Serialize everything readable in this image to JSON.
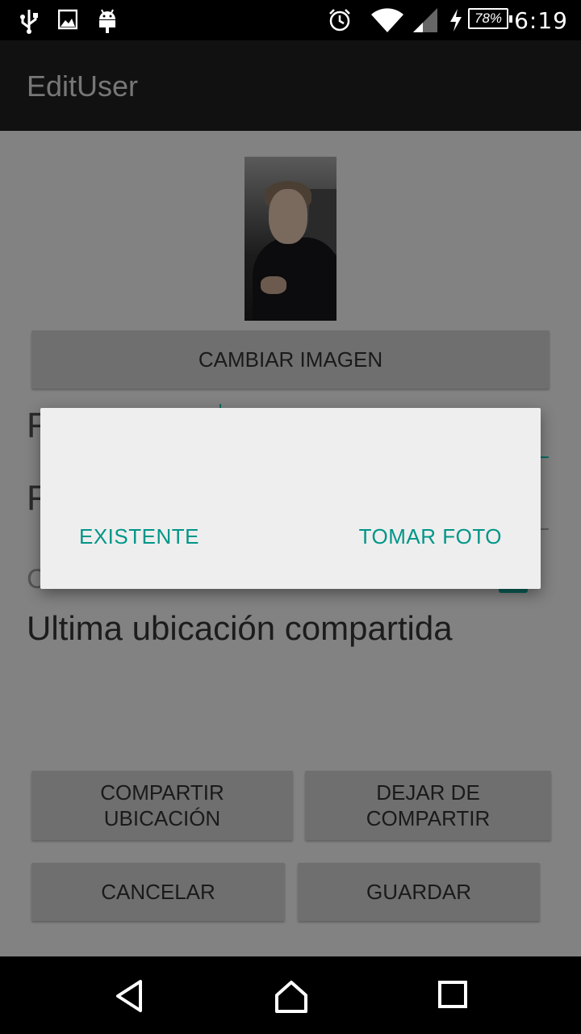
{
  "status_bar": {
    "time": "6:19",
    "battery": "78%",
    "icons": [
      "usb-icon",
      "image-icon",
      "android-icon",
      "alarm-icon",
      "wifi-icon",
      "signal-icon",
      "charging-icon"
    ]
  },
  "app_bar": {
    "title": "EditUser"
  },
  "profile": {
    "change_image_label": "CAMBIAR IMAGEN"
  },
  "form": {
    "field1_partial": "F",
    "field2_partial": "F",
    "field3_partial": "C",
    "last_location_label": "Ultima ubicación compartida"
  },
  "actions": {
    "share_location": "COMPARTIR\nUBICACIÓN",
    "stop_sharing": "DEJAR DE\nCOMPARTIR",
    "cancel": "CANCELAR",
    "save": "GUARDAR"
  },
  "dialog": {
    "existing_label": "EXISTENTE",
    "take_photo_label": "TOMAR FOTO"
  },
  "colors": {
    "accent": "#009688",
    "dim_background": "#828282",
    "dialog_background": "#eeeeee"
  },
  "nav_bar": {
    "icons": [
      "back-icon",
      "home-icon",
      "recents-icon"
    ]
  }
}
